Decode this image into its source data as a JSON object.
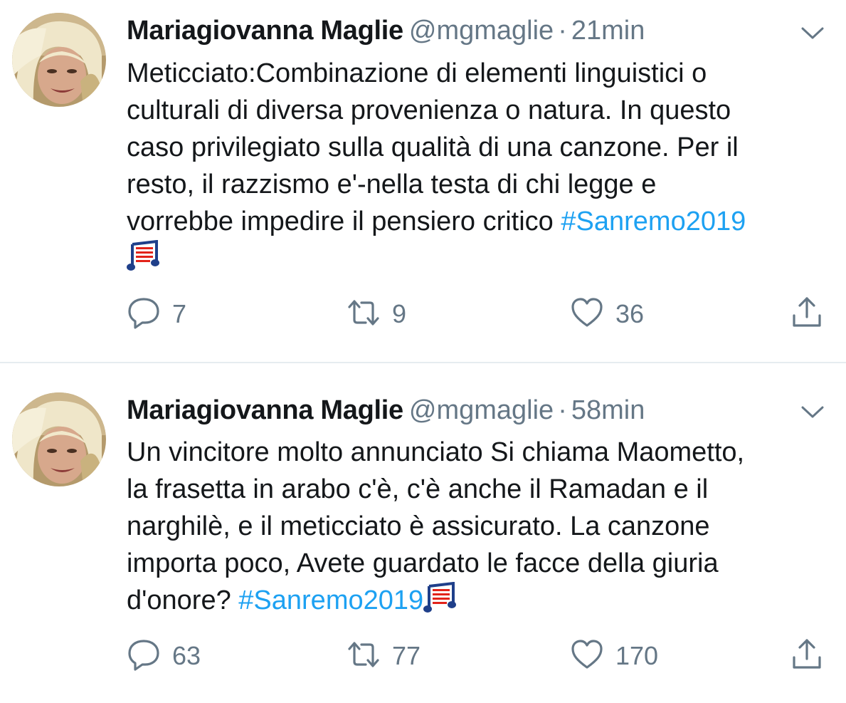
{
  "tweets": [
    {
      "author_name": "Mariagiovanna Maglie",
      "handle": "@mgmaglie",
      "separator": "·",
      "time": "21min",
      "lines": [
        "Meticciato:Combinazione di elementi linguistici o",
        "culturali di diversa provenienza o natura. In questo",
        "caso privilegiato sulla qualità di una canzone. Per il",
        "resto, il razzismo e'-nella testa  di chi legge e",
        "vorrebbe impedire il pensiero critico "
      ],
      "hashtag": "#Sanremo2019",
      "emoji": "musical-score-emoji",
      "replies": "7",
      "retweets": "9",
      "likes": "36"
    },
    {
      "author_name": "Mariagiovanna Maglie",
      "handle": "@mgmaglie",
      "separator": "·",
      "time": "58min",
      "lines": [
        "Un vincitore molto annunciato Si chiama Maometto,",
        "la frasetta in arabo c'è, c'è anche il Ramadan e il",
        "narghilè, e il meticciato è assicurato. La canzone",
        "importa poco, Avete guardato le facce della giuria",
        "d'onore? "
      ],
      "hashtag": "#Sanremo2019",
      "emoji": "musical-score-emoji",
      "replies": "63",
      "retweets": "77",
      "likes": "170"
    }
  ],
  "icons": {
    "reply": "reply-icon",
    "retweet": "retweet-icon",
    "like": "heart-icon",
    "share": "share-icon",
    "menu": "chevron-down-icon"
  },
  "colors": {
    "text": "#14171a",
    "secondary": "#657786",
    "hashtag": "#1da1f2",
    "divider": "#e6ecf0"
  }
}
